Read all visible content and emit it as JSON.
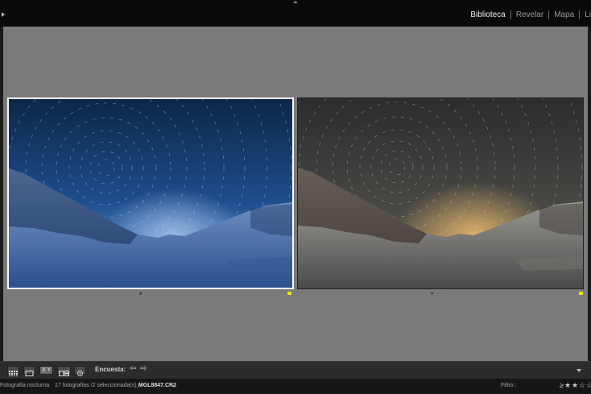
{
  "modules": [
    "Biblioteca",
    "Revelar",
    "Mapa",
    "Li"
  ],
  "active_module": "Biblioteca",
  "photos": [
    {
      "name": "photo-original",
      "rating": "★ · · · ·",
      "flag_color": "#f2e600",
      "selected": true
    },
    {
      "name": "photo-edited",
      "rating": "★ · · · ·",
      "flag_color": "#f2e600",
      "selected": false
    }
  ],
  "toolbar": {
    "encuesta_label": "Encuesta:",
    "prev_arrow": "⇦",
    "next_arrow": "⇨",
    "grid_view_icon": "grid-icon",
    "loupe_view_icon": "loupe-icon",
    "compare_view_icon": "compare-icon",
    "survey_view_icon": "survey-icon",
    "people_view_icon": "people-icon",
    "xy_label": "X Y"
  },
  "status": {
    "collection": "Fotografía nocturna",
    "count": "17 fotografías /2 seleccionada(s) /",
    "filename": "_MGL8847.CR2",
    "filter_label": "Filtro :",
    "filter_stars": "≥★★☆☆"
  },
  "colors": {
    "panel_bg": "#7a7a7a",
    "toolbar_bg": "#2c2c2c",
    "flag": "#f2e600"
  }
}
